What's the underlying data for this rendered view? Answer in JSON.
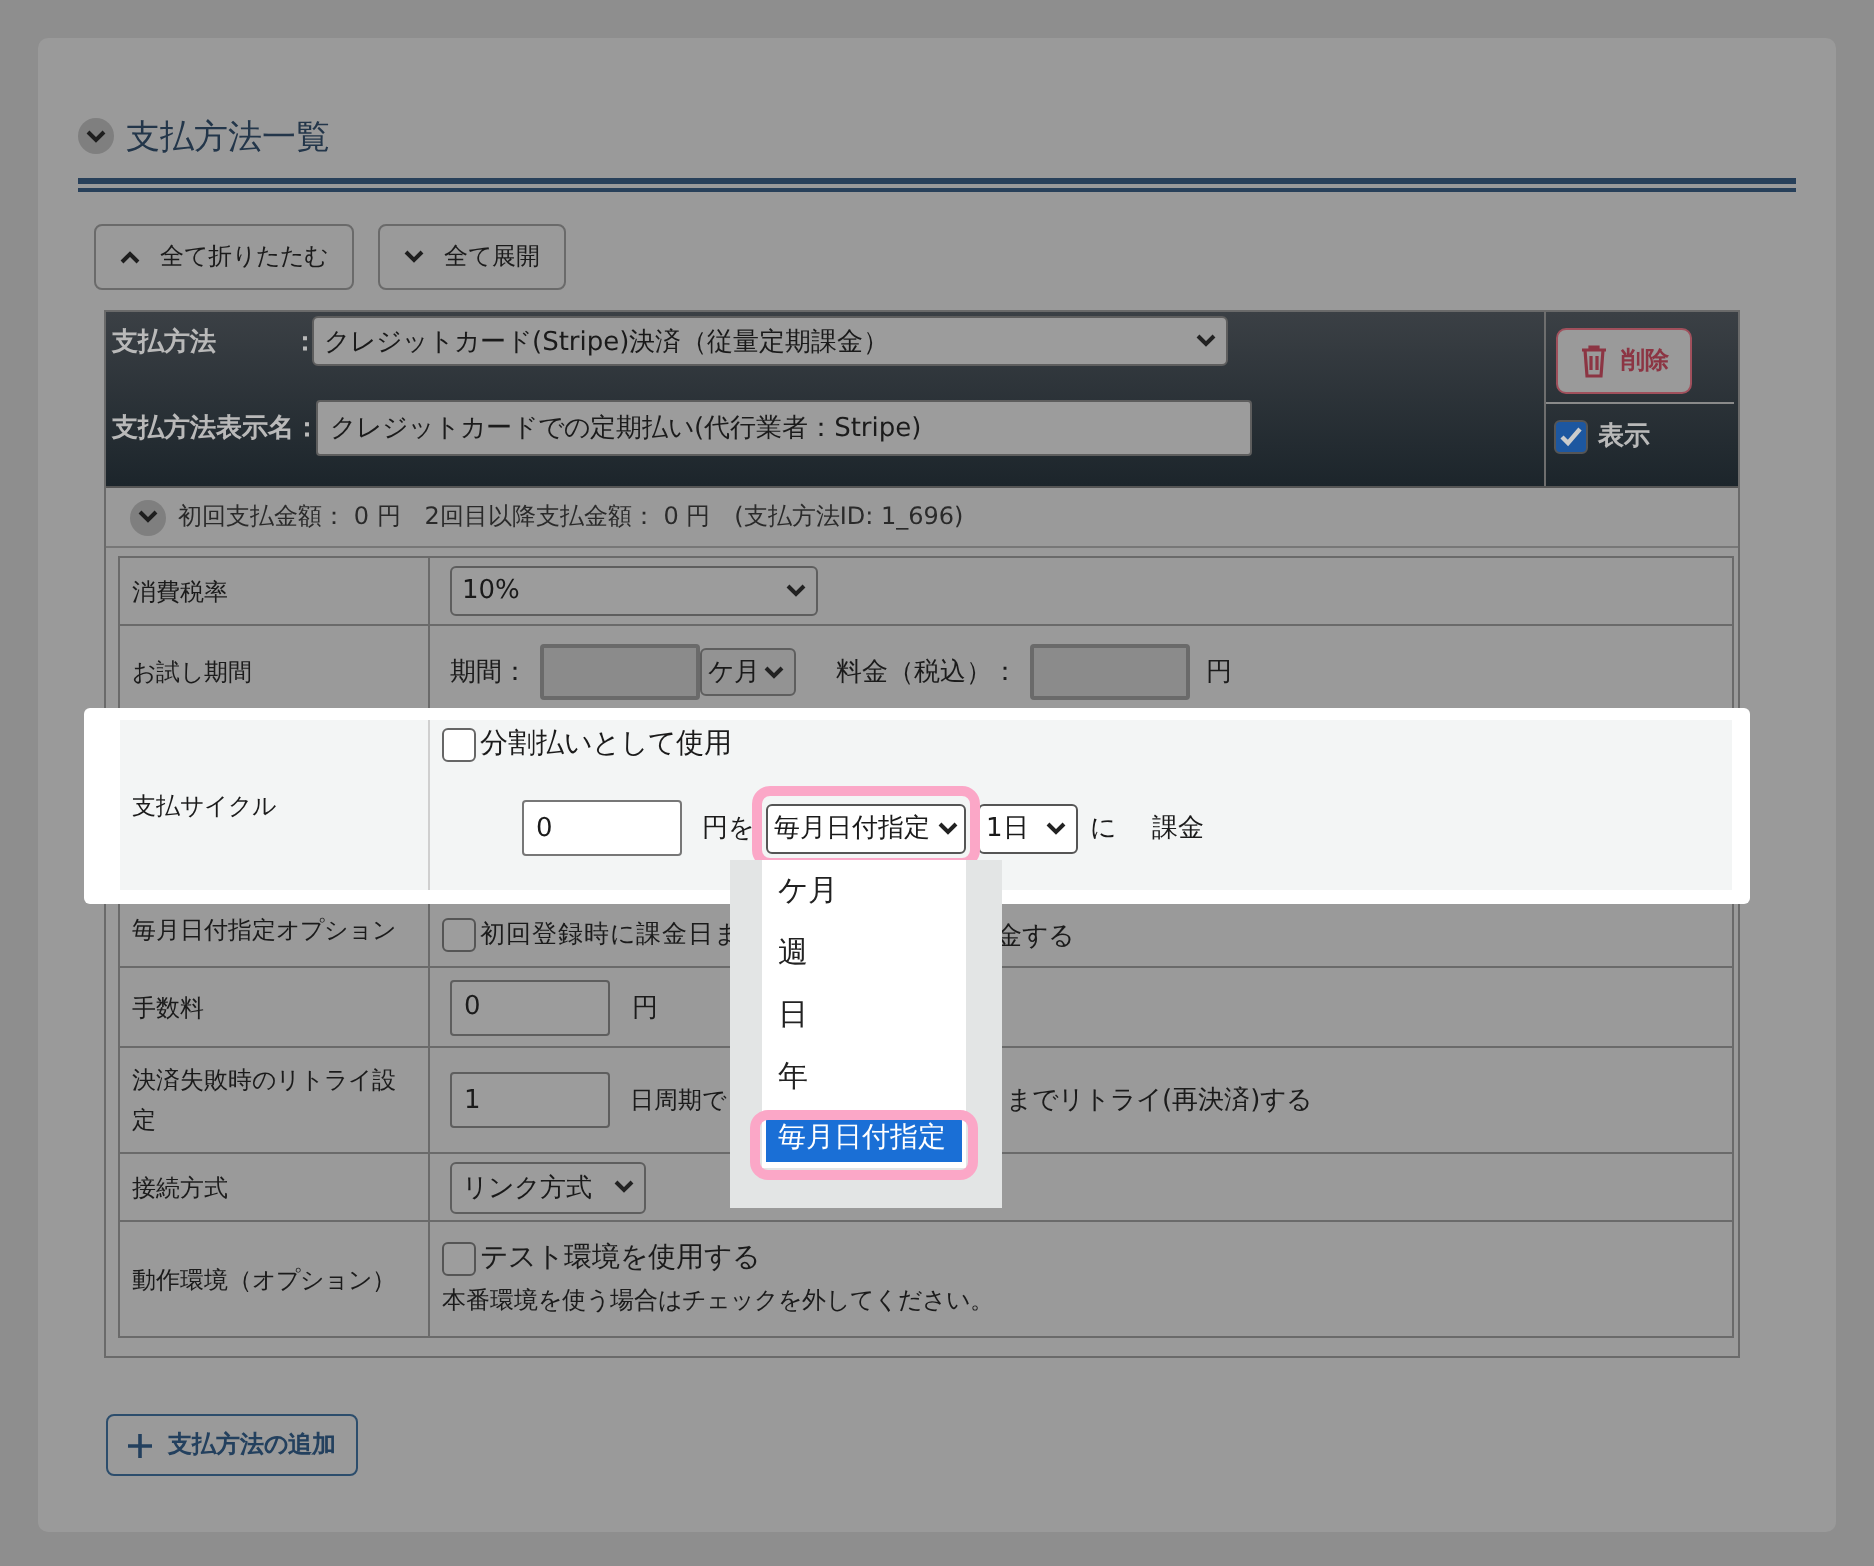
{
  "section": {
    "title": "支払方法一覧"
  },
  "toolbar": [
    {
      "label": "全て折りたたむ",
      "kind": "collapse"
    },
    {
      "label": "全て展開",
      "kind": "expand"
    }
  ],
  "method": {
    "type_label": "支払方法",
    "type_colon": "：",
    "type_value": "クレジットカード(Stripe)決済（従量定期課金）",
    "name_label": "支払方法表示名：",
    "name_value": "クレジットカードでの定期払い(代行業者：Stripe)",
    "delete_button": "削除",
    "visible": {
      "label": "表示",
      "checked": true
    }
  },
  "summary": "初回支払金額： 0 円　2回目以降支払金額： 0 円　(支払方法ID: 1_696)",
  "settings": [
    {
      "kind": "select",
      "label": "消費税率",
      "value": "10%",
      "spotlight": false
    },
    {
      "kind": "trial",
      "label": "お試し期間",
      "period_label": "期間：",
      "unit": "ケ月",
      "price_label": "料金（税込）：",
      "currency": "円",
      "spotlight": false
    },
    {
      "kind": "cycle",
      "label": "支払サイクル",
      "spotlight": true,
      "installment": {
        "label": "分割払いとして使用",
        "checked": false
      },
      "amount": "0",
      "amount_suffix": "円を",
      "cycle_type": "毎月日付指定",
      "cycle_highlighted": true,
      "day": "1日",
      "day_suffix": "に",
      "action": "課金",
      "options": [
        {
          "label": "ケ月",
          "selected": false,
          "highlighted": false
        },
        {
          "label": "週",
          "selected": false,
          "highlighted": false
        },
        {
          "label": "日",
          "selected": false,
          "highlighted": false
        },
        {
          "label": "年",
          "selected": false,
          "highlighted": false
        },
        {
          "label": "毎月日付指定",
          "selected": true,
          "highlighted": true
        }
      ]
    },
    {
      "kind": "split_checkbox",
      "label": "毎月日付指定オプション",
      "checked": false,
      "text_parts": [
        "初回登録時に課金日ま",
        "金する"
      ],
      "spotlight": false
    },
    {
      "kind": "number",
      "label": "手数料",
      "value": "0",
      "suffix": "円",
      "spotlight": false
    },
    {
      "kind": "retry",
      "label": "決済失敗時のリトライ設定",
      "value": "1",
      "middle": "日周期で",
      "tail": "までリトライ(再決済)する",
      "spotlight": false
    },
    {
      "kind": "select",
      "label": "接続方式",
      "value": "リンク方式",
      "spotlight": false
    },
    {
      "kind": "checkbox",
      "label": "動作環境（オプション）",
      "checked": false,
      "text": "テスト環境を使用する",
      "note": "本番環境を使う場合はチェックを外してください。",
      "spotlight": false
    }
  ],
  "add_button": "支払方法の追加"
}
